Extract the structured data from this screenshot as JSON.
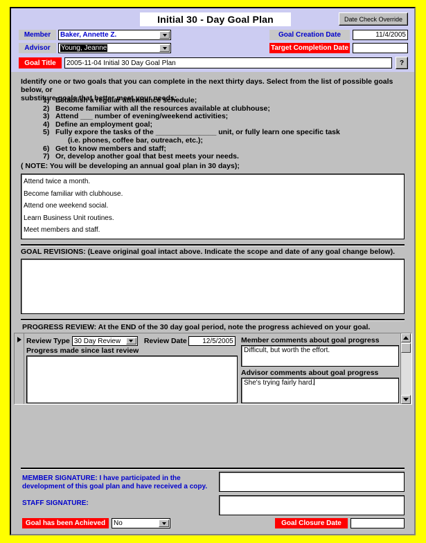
{
  "window": {
    "title": "Initial 30 - Day Goal Plan",
    "accent_red": "#ff0000",
    "accent_blue": "#0000cc",
    "header_bg": "#ccccf2",
    "body_bg": "#c0c0c0",
    "page_bg": "#ffff00"
  },
  "header": {
    "title": "Initial 30 - Day Goal Plan",
    "date_check_override": "Date Check Override",
    "member_label": "Member",
    "member_value": "Baker, Annette Z.",
    "advisor_label": "Advisor",
    "advisor_value": "Young, Jeanne",
    "goal_creation_date_label": "Goal Creation Date",
    "goal_creation_date_value": "11/4/2005",
    "target_completion_date_label": "Target Completion Date",
    "target_completion_date_value": "",
    "goal_title_label": "Goal Title",
    "goal_title_value": "2005-11-04  Initial 30 Day Goal Plan",
    "help_button": "?"
  },
  "instructions": {
    "intro_line1": "Identify one or two goals that you can complete in the next thirty days.  Select from the list of possible goals below, or",
    "intro_line2": "substiture goals that better meet your needs:",
    "goals": [
      {
        "num": "1)",
        "text": "Establish a regular attendance schedule;"
      },
      {
        "num": "2)",
        "text": "Become familiar with all the resources available at clubhouse;"
      },
      {
        "num": "3)",
        "text": "Attend ___ number of evening/weekend activities;"
      },
      {
        "num": "4)",
        "text": "Define an employment goal;"
      },
      {
        "num": "5)",
        "text": "Fully expore the tasks of the _______________ unit, or fully learn one specific task"
      },
      {
        "num": "",
        "text": "(i.e. phones, coffee bar, outreach, etc.);"
      },
      {
        "num": "6)",
        "text": "Get to know members and staff;"
      },
      {
        "num": "7)",
        "text": "Or, develop another goal that best meets your needs."
      }
    ],
    "note": "( NOTE: You will be developing an annual goal plan in 30 days);"
  },
  "goal_text": {
    "lines": [
      "Attend twice a month.",
      "Become familiar with clubhouse.",
      "Attend one weekend social.",
      "Learn Business Unit routines.",
      "Meet members and staff."
    ]
  },
  "goal_revisions": {
    "heading": "GOAL REVISIONS:  (Leave original goal intact above.  Indicate the scope and date of any goal change below).",
    "value": ""
  },
  "progress_review": {
    "heading": "PROGRESS REVIEW:  At the END of the 30 day goal period, note the progress achieved on your goal.",
    "review_type_label": "Review Type",
    "review_type_value": "30 Day Review",
    "review_date_label": "Review Date",
    "review_date_value": "12/5/2005",
    "progress_label": "Progress made since last review",
    "progress_value": "",
    "member_comments_label": "Member comments about goal progress",
    "member_comments_value": "Difficult, but worth the effort.",
    "advisor_comments_label": "Advisor comments about goal progress",
    "advisor_comments_value": "She's trying fairly hard."
  },
  "signatures": {
    "member_line1": "MEMBER SIGNATURE:  I have participated in the",
    "member_line2": "development of this goal plan and have received a copy.",
    "member_value": "",
    "staff_label": "STAFF SIGNATURE:",
    "staff_value": "",
    "goal_achieved_label": "Goal has been Achieved",
    "goal_achieved_value": "No",
    "goal_closure_date_label": "Goal Closure Date",
    "goal_closure_date_value": ""
  }
}
